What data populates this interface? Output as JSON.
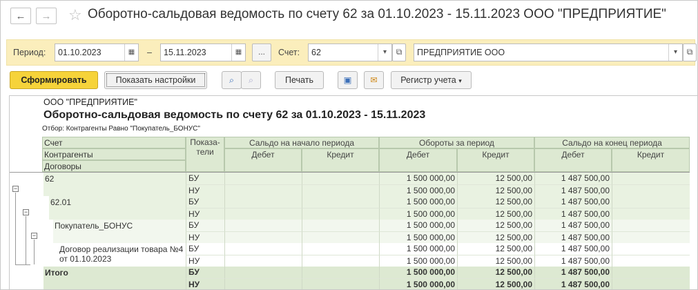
{
  "window": {
    "title": "Оборотно-сальдовая ведомость по счету 62 за 01.10.2023 - 15.11.2023 ООО \"ПРЕДПРИЯТИЕ\"",
    "back": "←",
    "forward": "→"
  },
  "filters": {
    "period_label": "Период:",
    "date_from": "01.10.2023",
    "dash": "–",
    "date_to": "15.11.2023",
    "ellipsis": "...",
    "account_label": "Счет:",
    "account": "62",
    "organization": "ПРЕДПРИЯТИЕ ООО"
  },
  "toolbar": {
    "generate": "Сформировать",
    "settings": "Показать настройки",
    "print": "Печать",
    "register": "Регистр учета"
  },
  "report": {
    "org": "ООО \"ПРЕДПРИЯТИЕ\"",
    "title": "Оборотно-сальдовая ведомость по счету 62 за 01.10.2023 - 15.11.2023",
    "filter": "Отбор: Контрагенты Равно \"Покупатель_БОНУС\"",
    "headers": {
      "account": "Счет",
      "counterparties": "Контрагенты",
      "contracts": "Договоры",
      "indicators": "Показа-\nтели",
      "opening": "Сальдо на начало периода",
      "turnover": "Обороты за период",
      "closing": "Сальдо на конец периода",
      "debit": "Дебет",
      "credit": "Кредит"
    },
    "rows": [
      {
        "name": "62",
        "ind": [
          "БУ",
          "НУ"
        ],
        "vals": [
          [
            "",
            "",
            "1 500 000,00",
            "12 500,00",
            "1 487 500,00",
            ""
          ],
          [
            "",
            "",
            "1 500 000,00",
            "12 500,00",
            "1 487 500,00",
            ""
          ]
        ]
      },
      {
        "name": "62.01",
        "ind": [
          "БУ",
          "НУ"
        ],
        "vals": [
          [
            "",
            "",
            "1 500 000,00",
            "12 500,00",
            "1 487 500,00",
            ""
          ],
          [
            "",
            "",
            "1 500 000,00",
            "12 500,00",
            "1 487 500,00",
            ""
          ]
        ]
      },
      {
        "name": "Покупатель_БОНУС",
        "ind": [
          "БУ",
          "НУ"
        ],
        "vals": [
          [
            "",
            "",
            "1 500 000,00",
            "12 500,00",
            "1 487 500,00",
            ""
          ],
          [
            "",
            "",
            "1 500 000,00",
            "12 500,00",
            "1 487 500,00",
            ""
          ]
        ]
      },
      {
        "name": "Договор реализации товара №4\nот 01.10.2023",
        "ind": [
          "БУ",
          "НУ"
        ],
        "vals": [
          [
            "",
            "",
            "1 500 000,00",
            "12 500,00",
            "1 487 500,00",
            ""
          ],
          [
            "",
            "",
            "1 500 000,00",
            "12 500,00",
            "1 487 500,00",
            ""
          ]
        ]
      },
      {
        "name": "Итого",
        "ind": [
          "БУ",
          "НУ"
        ],
        "vals": [
          [
            "",
            "",
            "1 500 000,00",
            "12 500,00",
            "1 487 500,00",
            ""
          ],
          [
            "",
            "",
            "1 500 000,00",
            "12 500,00",
            "1 487 500,00",
            ""
          ]
        ]
      }
    ]
  },
  "colors": {
    "accent": "#f6d33a",
    "filter_bg": "#fbeebc",
    "header_bg": "#dde9d2",
    "level1_bg": "#e9f2e1",
    "level2_bg": "#f2f7ee",
    "total_bg": "#dde9d2"
  }
}
